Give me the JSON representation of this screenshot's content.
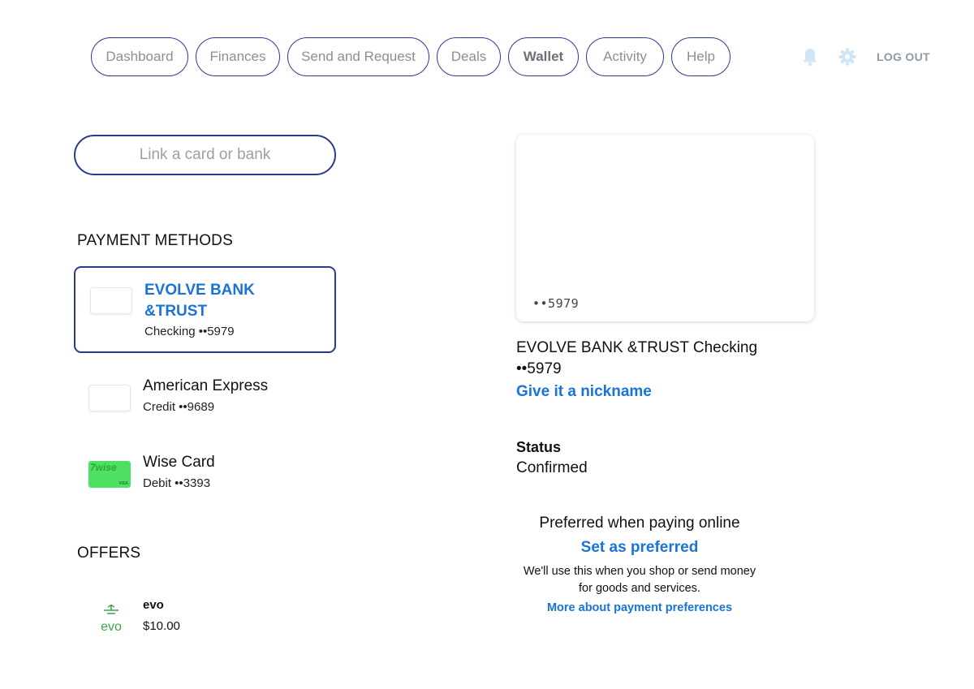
{
  "nav": {
    "tabs": [
      {
        "label": "Dashboard",
        "active": false
      },
      {
        "label": "Finances",
        "active": false
      },
      {
        "label": "Send and Request",
        "active": false
      },
      {
        "label": "Deals",
        "active": false
      },
      {
        "label": "Wallet",
        "active": true
      },
      {
        "label": "Activity",
        "active": false
      },
      {
        "label": "Help",
        "active": false
      }
    ],
    "icons": [
      "bell-icon",
      "gear-icon"
    ],
    "logout_label": "LOG OUT",
    "colors": {
      "pill_border": "#2b3a8f",
      "icon": "#cfe6f7"
    }
  },
  "left": {
    "link_button": "Link a card or bank",
    "payment_methods_title": "PAYMENT METHODS",
    "payment_methods": [
      {
        "name": "EVOLVE BANK &TRUST",
        "detail": "Checking ••5979",
        "selected": true
      },
      {
        "name": "American Express",
        "detail": "Credit ••9689",
        "selected": false
      },
      {
        "name": "Wise Card",
        "detail": "Debit ••3393",
        "selected": false,
        "thumb_text": "7wise",
        "thumb_brand": "VISA"
      }
    ],
    "offers_title": "OFFERS",
    "offers": [
      {
        "name": "evo",
        "amount": "$10.00",
        "logo_text": "evo"
      }
    ]
  },
  "detail": {
    "card_number": "••5979",
    "account_name": "EVOLVE BANK &TRUST Checking ••5979",
    "nickname_link": "Give it a nickname",
    "status_label": "Status",
    "status_value": "Confirmed",
    "preferred_heading": "Preferred when paying online",
    "set_preferred_link": "Set as preferred",
    "preferred_description": "We'll use this when you shop or send money for goods and services.",
    "more_link": "More about payment preferences",
    "colors": {
      "link": "#1a73d9"
    }
  }
}
